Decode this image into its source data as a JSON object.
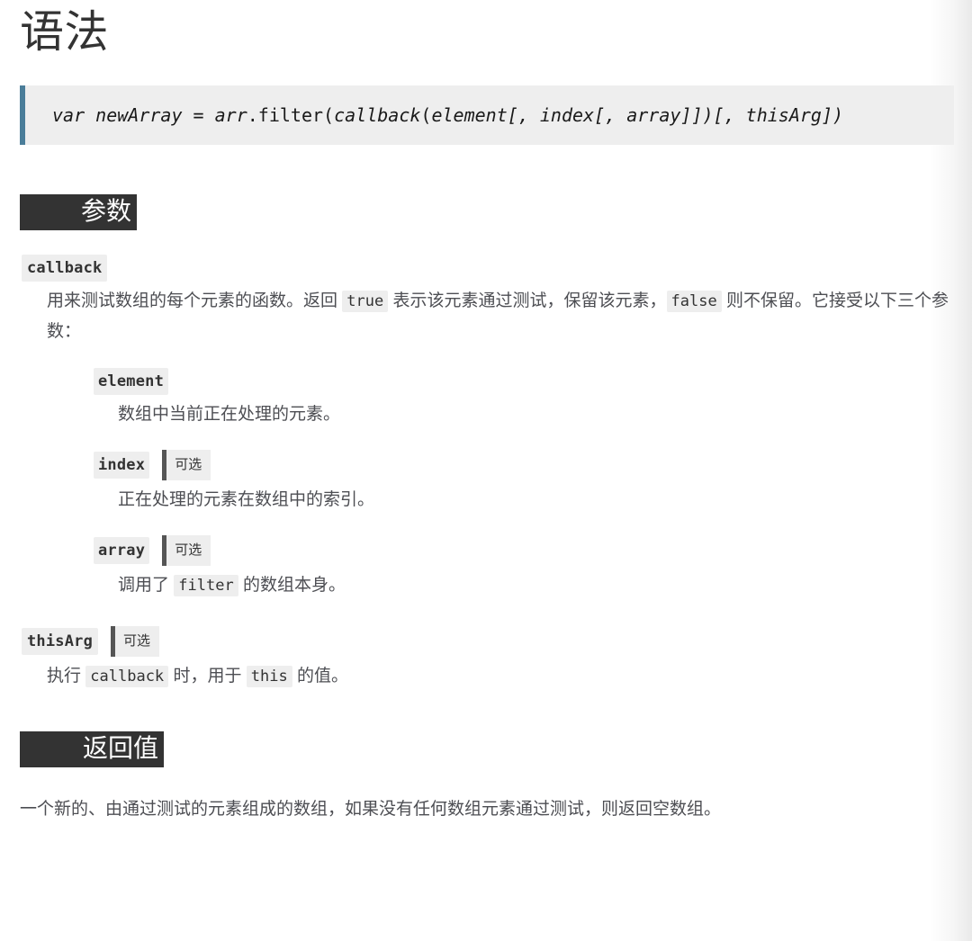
{
  "page": {
    "title": "语法",
    "background_color": "#ffffff",
    "text_color": "#4d4e53"
  },
  "syntax": {
    "accent_color": "#4a7d99",
    "background_color": "#eeeeee",
    "full_text": "var newArray = arr.filter(callback(element[, index[, array]])[, thisArg])",
    "tokens": {
      "declaration": "var newArray = arr",
      "dot": ".",
      "method": "filter",
      "open_paren": "(",
      "callback_name": "callback",
      "callback_open": "(",
      "element": "element",
      "index_group": "[, index",
      "array_group": "[, array]])",
      "this_arg_group": "[, thisArg])"
    }
  },
  "sections": [
    {
      "id": "parameters",
      "heading": "参数",
      "heading_bg": "#333333",
      "heading_fg": "#ffffff"
    },
    {
      "id": "return-value",
      "heading": "返回值",
      "heading_bg": "#333333",
      "heading_fg": "#ffffff"
    }
  ],
  "parameters": {
    "callback": {
      "name": "callback",
      "desc_part1": "用来测试数组的每个元素的函数。返回 ",
      "code_true": "true",
      "desc_part2": " 表示该元素通过测试，保留该元素，",
      "code_false": "false",
      "desc_part3": " 则不保留。它接受以下三个参数："
    },
    "nested": [
      {
        "name": "element",
        "optional": false,
        "optional_label": "",
        "description": "数组中当前正在处理的元素。"
      },
      {
        "name": "index",
        "optional": true,
        "optional_label": "可选",
        "description": "正在处理的元素在数组中的索引。"
      },
      {
        "name": "array",
        "optional": true,
        "optional_label": "可选",
        "desc_part1": "调用了 ",
        "code_inline": "filter",
        "desc_part2": " 的数组本身。"
      }
    ],
    "thisArg": {
      "name": "thisArg",
      "optional": true,
      "optional_label": "可选",
      "desc_part1": "执行 ",
      "code_callback": "callback",
      "desc_part2": " 时，用于 ",
      "code_this": "this",
      "desc_part3": " 的值。"
    }
  },
  "return_value": {
    "text": "一个新的、由通过测试的元素组成的数组，如果没有任何数组元素通过测试，则返回空数组。"
  }
}
